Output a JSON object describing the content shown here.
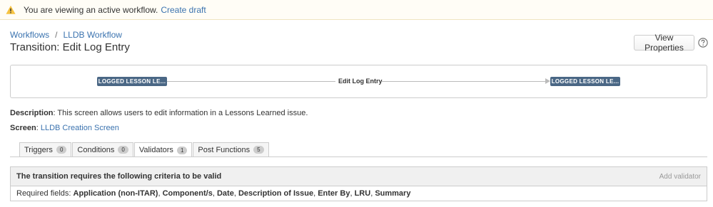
{
  "banner": {
    "text": "You are viewing an active workflow.",
    "link": "Create draft",
    "icon": "warning-icon",
    "color": "#f6c342"
  },
  "breadcrumb": {
    "items": [
      "Workflows",
      "LLDB Workflow"
    ],
    "separator": "/"
  },
  "page": {
    "title": "Transition: Edit Log Entry",
    "view_properties_label": "View Properties",
    "help_icon": "help-icon"
  },
  "diagram": {
    "from_status": "LOGGED LESSON LE...",
    "transition": "Edit Log Entry",
    "to_status": "LOGGED LESSON LE...",
    "status_color": "#4a6785"
  },
  "description": {
    "label": "Description",
    "text": ": This screen allows users to edit information in a Lessons Learned issue."
  },
  "screen": {
    "label": "Screen",
    "sep": ":",
    "value": "LLDB Creation Screen"
  },
  "tabs": [
    {
      "label": "Triggers",
      "count": "0"
    },
    {
      "label": "Conditions",
      "count": "0"
    },
    {
      "label": "Validators",
      "count": "1",
      "active": true
    },
    {
      "label": "Post Functions",
      "count": "5"
    }
  ],
  "validators": {
    "heading": "The transition requires the following criteria to be valid",
    "add_label": "Add validator",
    "required_prefix": "Required fields:",
    "fields": [
      "Application (non-ITAR)",
      "Component/s",
      "Date",
      "Description of Issue",
      "Enter By",
      "LRU",
      "Summary"
    ]
  },
  "colors": {
    "link": "#3b73af",
    "border": "#cccccc"
  }
}
